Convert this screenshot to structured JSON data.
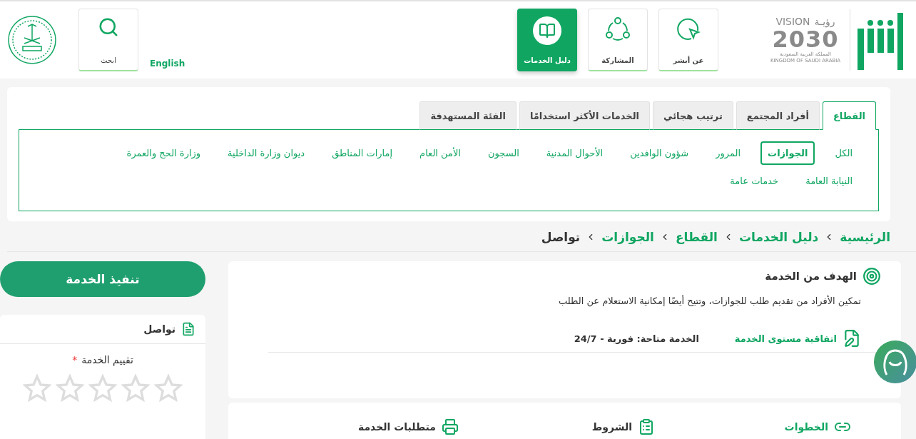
{
  "header": {
    "vision": {
      "latin": "VISION",
      "arabic": "رؤيـة",
      "year": "2030",
      "country_ar": "المملكة العربية السعودية",
      "country_en": "KINGDOM OF SAUDI ARABIA"
    },
    "nav": [
      {
        "label": "عن أبشر",
        "selected": false
      },
      {
        "label": "المشاركة",
        "selected": false
      },
      {
        "label": "دليل الخدمات",
        "selected": true
      }
    ],
    "language": "English",
    "search": {
      "label": "ابحث"
    }
  },
  "category_tabs": [
    {
      "label": "القطاع",
      "selected": true
    },
    {
      "label": "أفراد المجتمع",
      "selected": false
    },
    {
      "label": "ترتيب هجائي",
      "selected": false
    },
    {
      "label": "الخدمات الأكثر استخدامًا",
      "selected": false
    },
    {
      "label": "الفئة المستهدفة",
      "selected": false
    }
  ],
  "sectors": [
    {
      "label": "الكل",
      "selected": false
    },
    {
      "label": "الجوازات",
      "selected": true
    },
    {
      "label": "المرور",
      "selected": false
    },
    {
      "label": "شؤون الوافدين",
      "selected": false
    },
    {
      "label": "الأحوال المدنية",
      "selected": false
    },
    {
      "label": "السجون",
      "selected": false
    },
    {
      "label": "الأمن العام",
      "selected": false
    },
    {
      "label": "إمارات المناطق",
      "selected": false
    },
    {
      "label": "ديوان وزارة الداخلية",
      "selected": false
    },
    {
      "label": "وزارة الحج والعمرة",
      "selected": false
    },
    {
      "label": "النيابة العامة",
      "selected": false
    },
    {
      "label": "خدمات عامة",
      "selected": false
    }
  ],
  "breadcrumb": [
    {
      "label": "الرئيسية",
      "current": false
    },
    {
      "label": "دليل الخدمات",
      "current": false
    },
    {
      "label": "القطاع",
      "current": false
    },
    {
      "label": "الجوازات",
      "current": false
    },
    {
      "label": "تواصل",
      "current": true
    }
  ],
  "service": {
    "goal_title": "الهدف من الخدمة",
    "goal_text": "تمكين الأفراد من تقديم طلب للجوازات، وتتيح أيضًا إمكانية الاستعلام عن الطلب",
    "sla_label": "اتفاقية مستوى الخدمة",
    "availability": "الخدمة متاحة: فورية - 24/7"
  },
  "detail_tabs": [
    {
      "label": "الخطوات",
      "selected": true
    },
    {
      "label": "الشروط",
      "selected": false
    },
    {
      "label": "متطلبات الخدمة",
      "selected": false
    }
  ],
  "execute_button": "تنفيذ الخدمة",
  "side_card": {
    "title": "تواصل",
    "rating": {
      "label": "تقييم الخدمة",
      "required_mark": "*",
      "stars": 0
    }
  }
}
